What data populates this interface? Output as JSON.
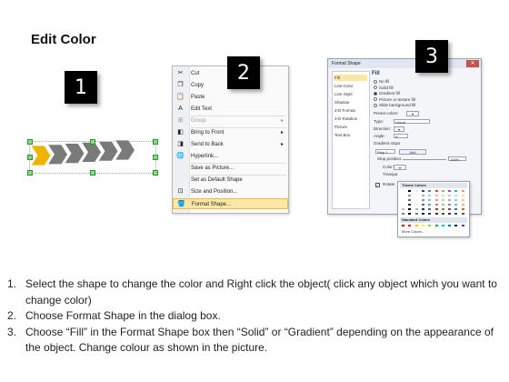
{
  "title": "Edit Color",
  "badges": [
    "1",
    "2",
    "3"
  ],
  "context_menu": {
    "items": [
      {
        "label": "Cut",
        "icon": "scissors-icon",
        "glyph": "✂",
        "state": "normal"
      },
      {
        "label": "Copy",
        "icon": "copy-icon",
        "glyph": "❐",
        "state": "normal"
      },
      {
        "label": "Paste",
        "icon": "clipboard-icon",
        "glyph": "📋",
        "state": "normal"
      },
      {
        "label": "Edit Text",
        "icon": "text-box-icon",
        "glyph": "A",
        "state": "normal"
      },
      {
        "label": "Group",
        "icon": "group-icon",
        "glyph": "⊞",
        "state": "disabled",
        "submenu": true
      },
      {
        "label": "Bring to Front",
        "icon": "bring-front-icon",
        "glyph": "◧",
        "state": "normal",
        "submenu": true
      },
      {
        "label": "Send to Back",
        "icon": "send-back-icon",
        "glyph": "◨",
        "state": "normal",
        "submenu": true
      },
      {
        "label": "Hyperlink...",
        "icon": "globe-link-icon",
        "glyph": "🌐",
        "state": "normal"
      },
      {
        "label": "Save as Picture...",
        "icon": "",
        "glyph": "",
        "state": "normal"
      },
      {
        "label": "Set as Default Shape",
        "icon": "",
        "glyph": "",
        "state": "normal"
      },
      {
        "label": "Size and Position...",
        "icon": "size-icon",
        "glyph": "⊡",
        "state": "normal"
      },
      {
        "label": "Format Shape...",
        "icon": "paint-bucket-icon",
        "glyph": "🪣",
        "state": "highlighted"
      }
    ]
  },
  "dialog": {
    "title": "Format Shape",
    "close": "✕",
    "nav": [
      "Fill",
      "Line Color",
      "Line Style",
      "Shadow",
      "3-D Format",
      "3-D Rotation",
      "Picture",
      "Text Box"
    ],
    "section": "Fill",
    "fill_options": [
      {
        "label": "No fill",
        "selected": false
      },
      {
        "label": "Solid fill",
        "selected": false
      },
      {
        "label": "Gradient fill",
        "selected": true
      },
      {
        "label": "Picture or texture fill",
        "selected": false
      },
      {
        "label": "Slide background fill",
        "selected": false
      }
    ],
    "fields": {
      "preset": "Preset colors:",
      "type_label": "Type:",
      "type_value": "Linear",
      "direction": "Direction:",
      "angle_label": "Angle:",
      "angle_value": "0°",
      "stops": "Gradient stops",
      "stop_value": "Stop 1",
      "add": "Add",
      "stop_pos_label": "Stop position:",
      "stop_pos_value": "100%",
      "color_label": "Color:",
      "transp_label": "Transpa",
      "rotate_label": "Rotate"
    },
    "palette": {
      "theme_label": "Theme Colors",
      "standard_label": "Standard Colors",
      "more_label": "More Colors...",
      "theme_row": [
        "#ffffff",
        "#000000",
        "#eeece1",
        "#1f497d",
        "#4f81bd",
        "#c0504d",
        "#9bbb59",
        "#8064a2",
        "#4bacc6",
        "#f79646"
      ],
      "standard_row": [
        "#c00000",
        "#ff0000",
        "#ffc000",
        "#ffff00",
        "#92d050",
        "#00b050",
        "#00b0f0",
        "#0070c0",
        "#002060",
        "#7030a0"
      ]
    }
  },
  "arrows": {
    "accent": "#f0b400",
    "gray": "#7a7a7a"
  },
  "steps": [
    {
      "num": "1.",
      "text": "Select the shape to change the color and Right click the object( click any object which you want to change color)"
    },
    {
      "num": "2.",
      "text": "Choose Format Shape in the dialog box."
    },
    {
      "num": "3.",
      "text": "Choose “Fill” in the Format Shape box then “Solid” or “Gradient” depending on the appearance of the object. Change colour as shown in the picture."
    }
  ]
}
